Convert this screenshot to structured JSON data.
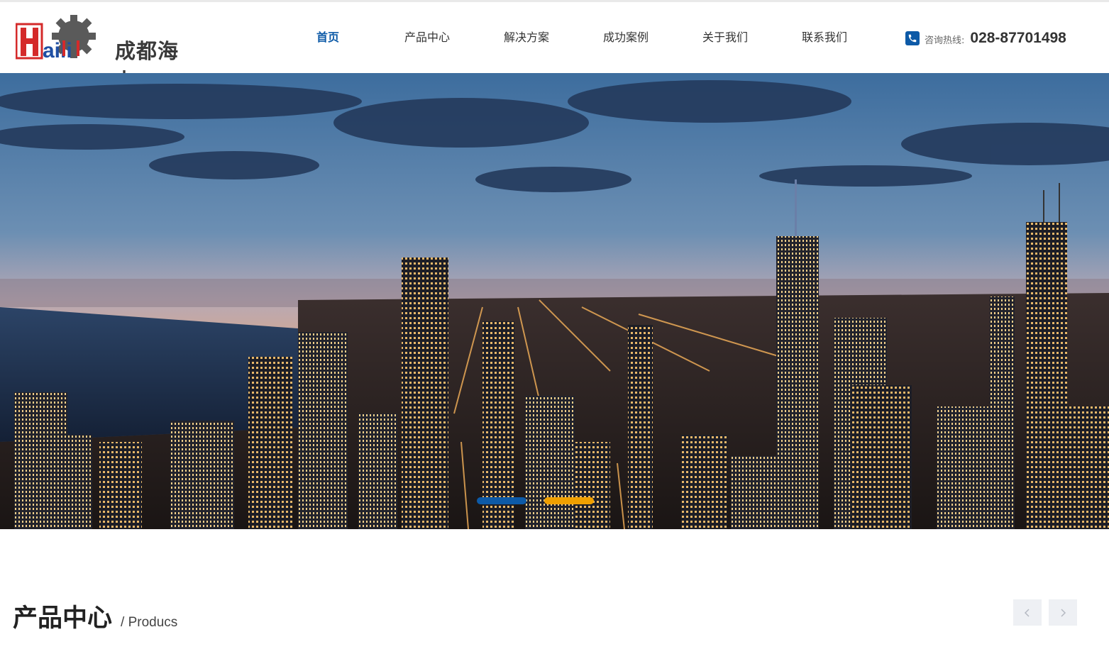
{
  "header": {
    "logo_wordmark": "Haili",
    "logo_text": "成都海力",
    "nav": [
      {
        "label": "首页",
        "active": true
      },
      {
        "label": "产品中心",
        "active": false
      },
      {
        "label": "解决方案",
        "active": false
      },
      {
        "label": "成功案例",
        "active": false
      },
      {
        "label": "关于我们",
        "active": false
      },
      {
        "label": "联系我们",
        "active": false
      }
    ],
    "hotline_label": "咨询热线:",
    "hotline_number": "028-87701498",
    "phone_icon": "phone-icon"
  },
  "banner": {
    "image": "city-skyline-night",
    "slides": 2,
    "active_slide": 1,
    "dot_colors": [
      "#0d5aa7",
      "#f0a000"
    ]
  },
  "products_section": {
    "title_cn": "产品中心",
    "title_en": "/ Producs",
    "prev_icon": "chevron-left-icon",
    "next_icon": "chevron-right-icon"
  },
  "colors": {
    "brand_blue": "#0d5aa7",
    "accent_orange": "#f0a000",
    "logo_red": "#d42a2a"
  }
}
